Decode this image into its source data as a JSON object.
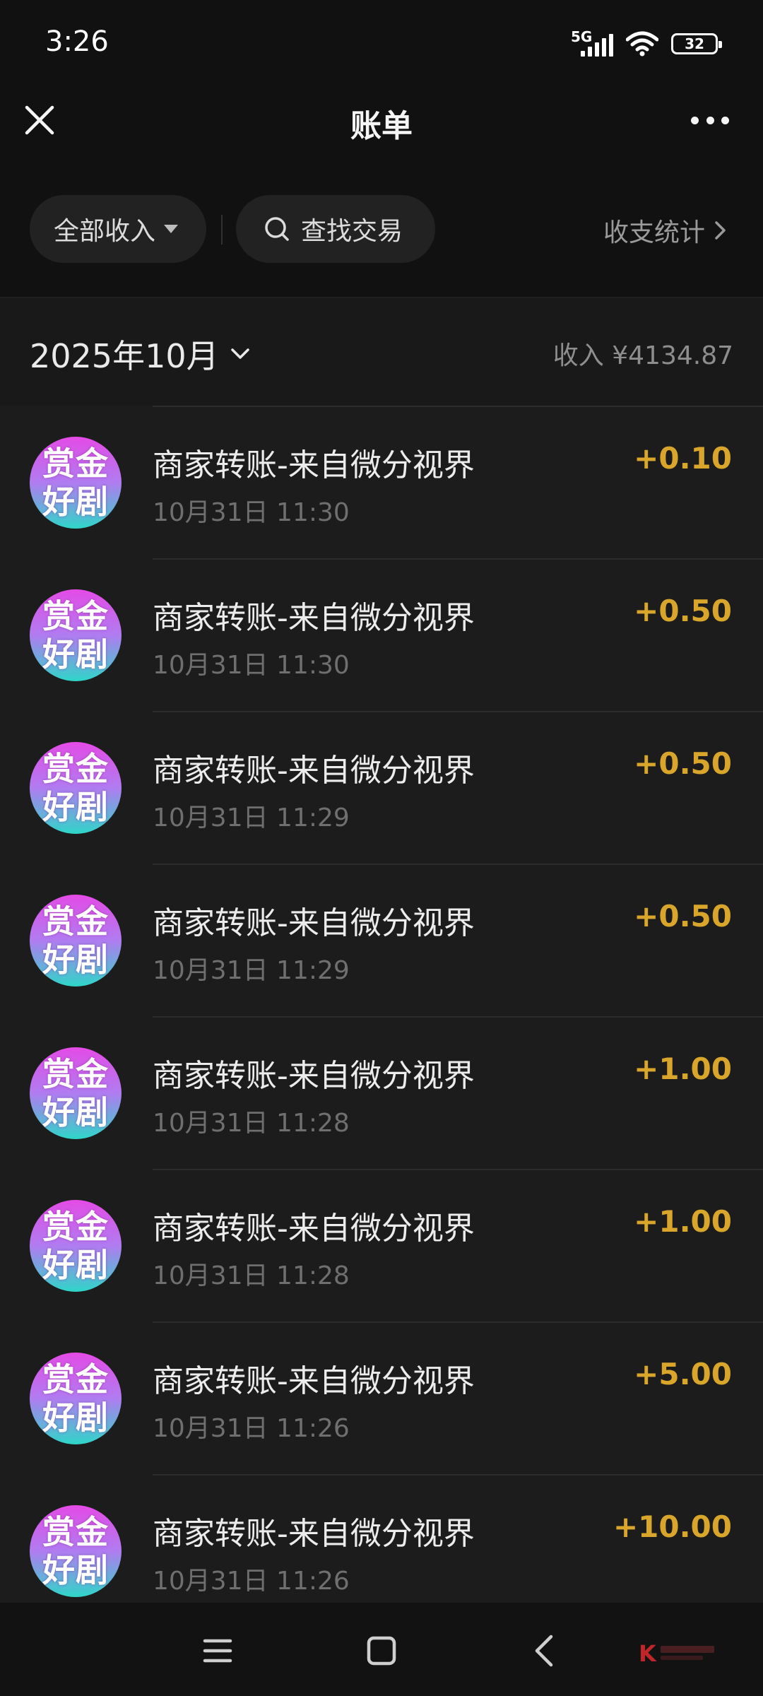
{
  "status": {
    "time": "3:26",
    "network": "5G",
    "battery": "32"
  },
  "header": {
    "title": "账单"
  },
  "filters": {
    "type_label": "全部收入",
    "search_label": "查找交易",
    "stats_label": "收支统计"
  },
  "month": {
    "label": "2025年10月",
    "income": "收入 ¥4134.87"
  },
  "transactions": [
    {
      "avatar_top": "赏金",
      "avatar_bottom": "好剧",
      "title": "商家转账-来自微分视界",
      "time": "10月31日 11:30",
      "amount": "+0.10"
    },
    {
      "avatar_top": "赏金",
      "avatar_bottom": "好剧",
      "title": "商家转账-来自微分视界",
      "time": "10月31日 11:30",
      "amount": "+0.50"
    },
    {
      "avatar_top": "赏金",
      "avatar_bottom": "好剧",
      "title": "商家转账-来自微分视界",
      "time": "10月31日 11:29",
      "amount": "+0.50"
    },
    {
      "avatar_top": "赏金",
      "avatar_bottom": "好剧",
      "title": "商家转账-来自微分视界",
      "time": "10月31日 11:29",
      "amount": "+0.50"
    },
    {
      "avatar_top": "赏金",
      "avatar_bottom": "好剧",
      "title": "商家转账-来自微分视界",
      "time": "10月31日 11:28",
      "amount": "+1.00"
    },
    {
      "avatar_top": "赏金",
      "avatar_bottom": "好剧",
      "title": "商家转账-来自微分视界",
      "time": "10月31日 11:28",
      "amount": "+1.00"
    },
    {
      "avatar_top": "赏金",
      "avatar_bottom": "好剧",
      "title": "商家转账-来自微分视界",
      "time": "10月31日 11:26",
      "amount": "+5.00"
    },
    {
      "avatar_top": "赏金",
      "avatar_bottom": "好剧",
      "title": "商家转账-来自微分视界",
      "time": "10月31日 11:26",
      "amount": "+10.00"
    }
  ],
  "colors": {
    "background": "#111111",
    "list_background": "#1c1c1c",
    "amount": "#d9a52a",
    "secondary_text": "#6f6f6f"
  },
  "icons": {
    "close": "close-icon",
    "more": "more-icon",
    "search": "search-icon",
    "chevron": "chevron-right-icon",
    "menu": "menu-icon",
    "home": "home-icon",
    "back": "back-icon"
  }
}
